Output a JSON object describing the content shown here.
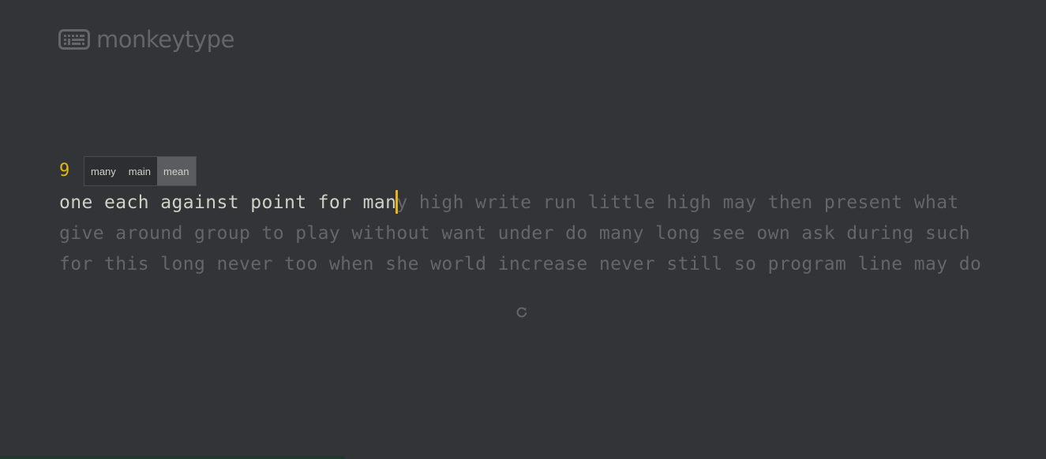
{
  "header": {
    "logo_text": "monkeytype"
  },
  "test": {
    "word_counter": "9",
    "typed_text": "one each against point for man",
    "line1_rest": "y high write run little high may then present what",
    "line2": "give around group to play without want under do many long see own ask during such",
    "line3": "for this long never too when she world increase never still so program line may do",
    "progress_fraction": 0.33
  },
  "suggestions": {
    "items": [
      "many",
      "main",
      "mean"
    ],
    "active": "mean"
  },
  "colors": {
    "background": "#323437",
    "main": "#e2b714",
    "sub": "#646669",
    "text": "#d1d0c5"
  },
  "icons": {
    "logo": "keyboard-icon",
    "restart": "restart-icon"
  }
}
